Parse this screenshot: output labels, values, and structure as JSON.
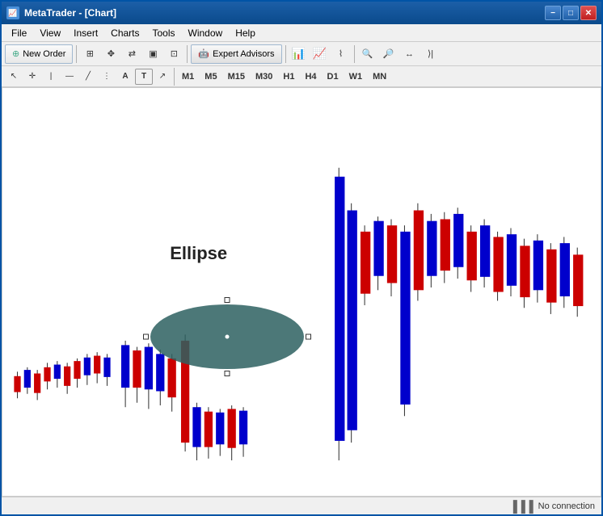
{
  "window": {
    "title": "MetaTrader - [Chart]"
  },
  "title_bar": {
    "icon": "📈",
    "title": "MetaTrader - [Chart]",
    "minimize_label": "−",
    "restore_label": "□",
    "close_label": "✕"
  },
  "menu": {
    "items": [
      "File",
      "View",
      "Insert",
      "Charts",
      "Tools",
      "Window",
      "Help"
    ]
  },
  "toolbar1": {
    "new_order_label": "New Order",
    "expert_advisors_label": "Expert Advisors"
  },
  "toolbar2": {
    "periods": [
      "M1",
      "M5",
      "M15",
      "M30",
      "H1",
      "H4",
      "D1",
      "W1",
      "MN"
    ]
  },
  "chart": {
    "ellipse_label": "Ellipse"
  },
  "status": {
    "connection": "No connection"
  }
}
